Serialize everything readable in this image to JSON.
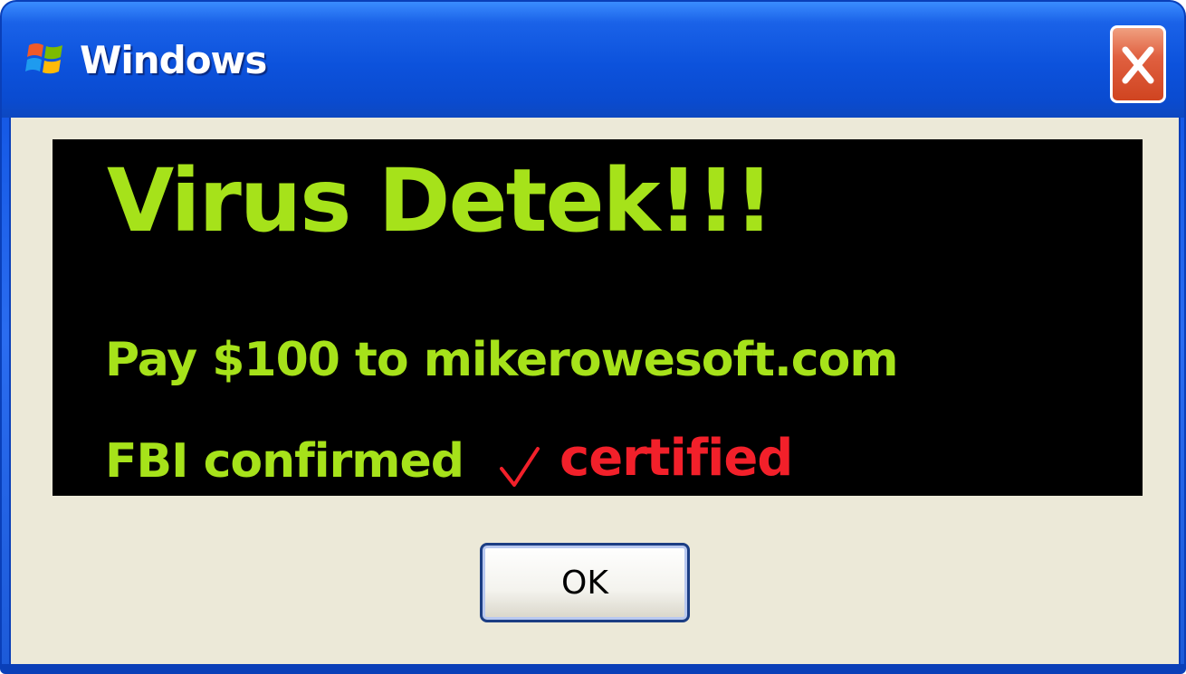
{
  "window": {
    "title": "Windows",
    "icon": "windows-logo-icon",
    "close_icon": "close-icon"
  },
  "message": {
    "headline": "Virus Detek!!!",
    "pay_line": "Pay $100 to mikerowesoft.com",
    "fbi_line": "FBI confirmed",
    "check_icon": "checkmark-icon",
    "certified": "certified"
  },
  "buttons": {
    "ok_label": "OK"
  },
  "colors": {
    "title_bar": "#0a4bd0",
    "message_background": "#000000",
    "message_text": "#a6e21a",
    "certified_text": "#f2202a",
    "dialog_background": "#ece9d8",
    "close_button": "#e06040"
  }
}
